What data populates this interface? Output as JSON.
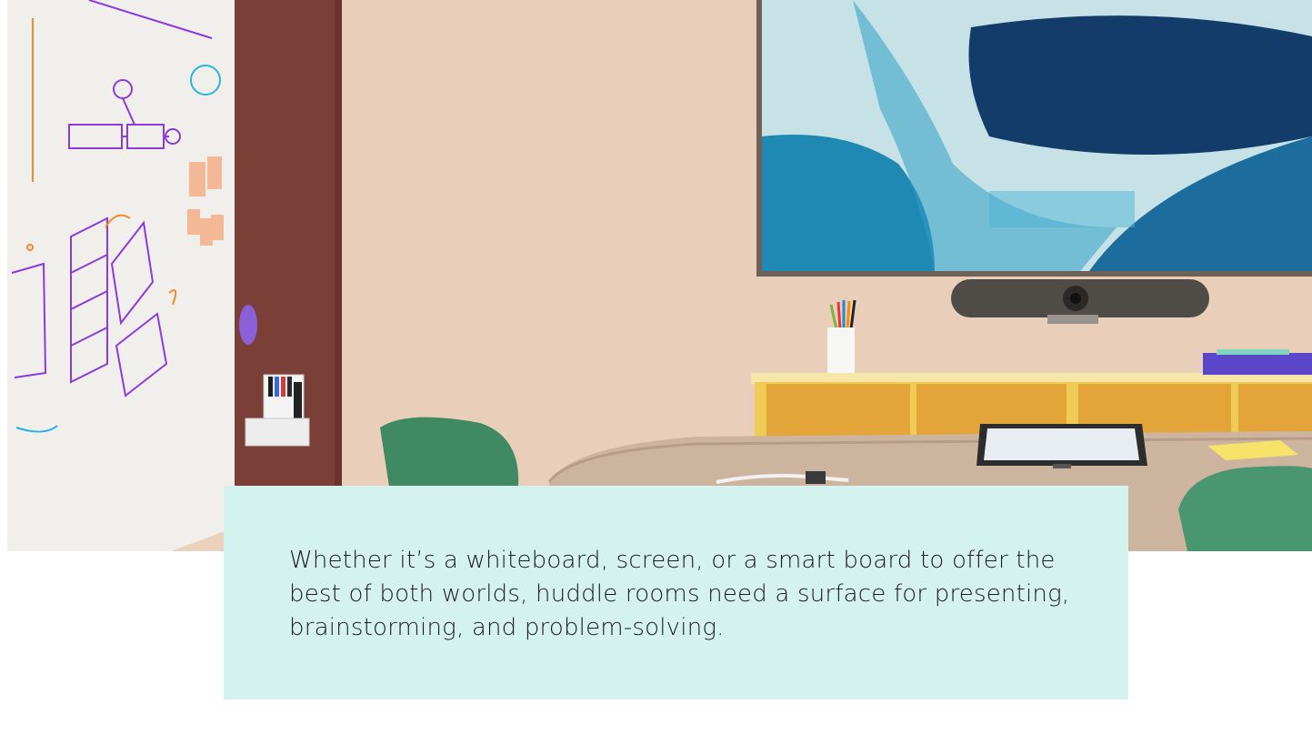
{
  "hero": {
    "image": "huddle-room-photo",
    "colors": {
      "wood_wall": "#ecd3be",
      "brown_wall": "#7a3f36",
      "whiteboard": "#f1efec",
      "artwork_teal": "#1f88b3",
      "artwork_navy": "#143c6a",
      "shelf_yellow": "#f0cc57",
      "chair_green": "#3f8a62",
      "table_wood": "#cdb49f",
      "marker_purple": "#8b3bd9",
      "marker_orange": "#f08a2c"
    }
  },
  "caption": {
    "text": "Whether it’s a whiteboard, screen, or a smart board to offer the best of both worlds, huddle rooms need a surface for presenting, brainstorming, and problem-solving.",
    "background": "#d4f3ee"
  }
}
